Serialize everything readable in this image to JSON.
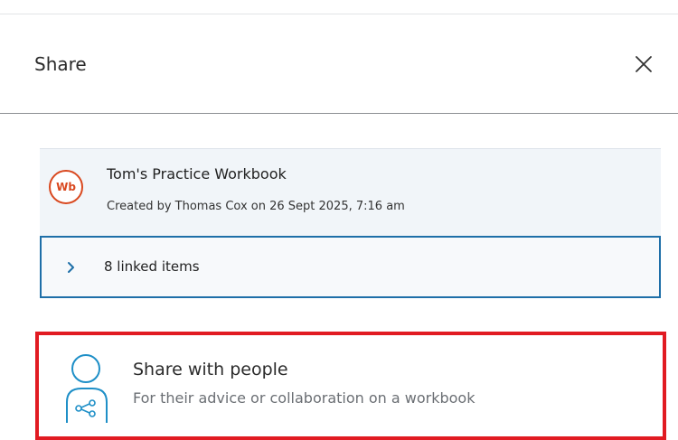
{
  "dialog": {
    "title": "Share",
    "close_icon": "close-icon"
  },
  "item": {
    "badge": "Wb",
    "name": "Tom's Practice Workbook",
    "meta": "Created by Thomas Cox on 26 Sept 2025, 7:16 am",
    "badge_color": "#d9481f"
  },
  "linked": {
    "label": "8 linked items",
    "icon": "chevron-right-icon"
  },
  "share_option": {
    "title": "Share with people",
    "subtitle": "For their advice or collaboration on a workbook",
    "icon": "share-people-icon",
    "highlight_color": "#e11b22"
  },
  "colors": {
    "accent": "#1e6fa8",
    "card_bg": "#f1f5f9"
  }
}
